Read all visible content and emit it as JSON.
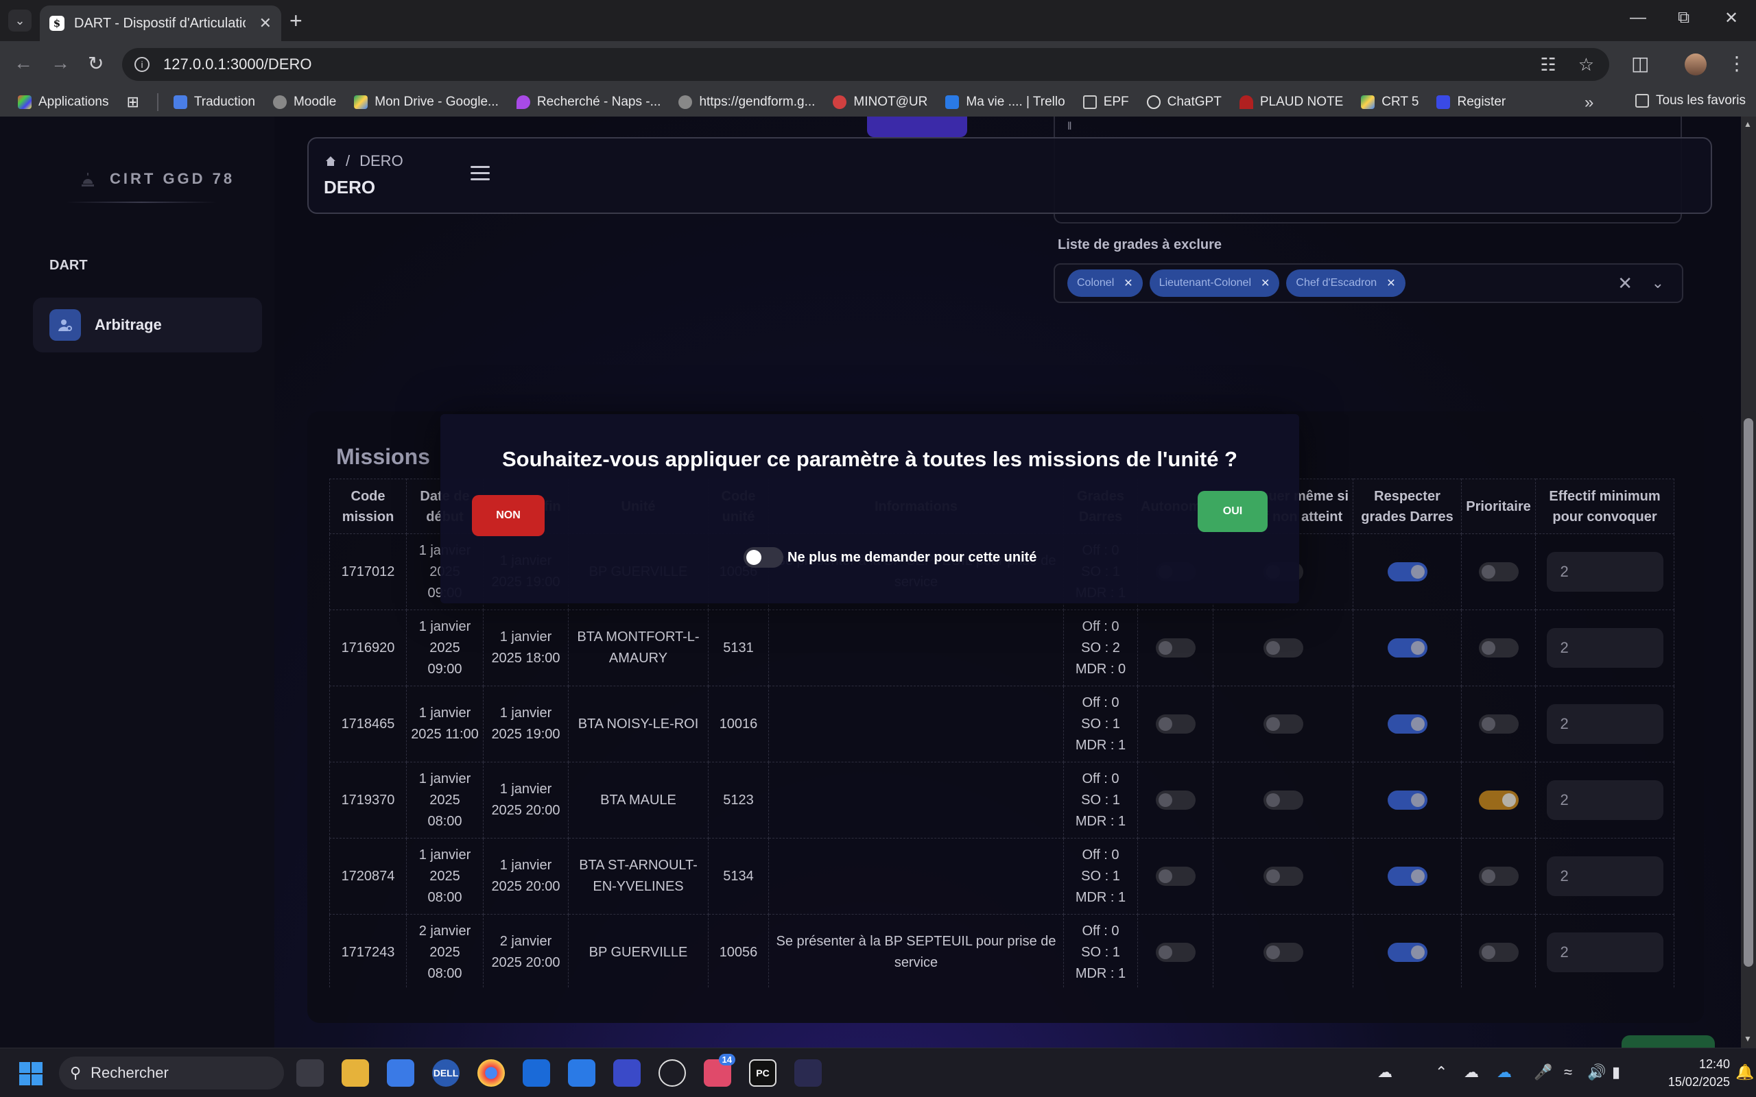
{
  "browser": {
    "tab_title": "DART - Dispostif d'Articulation d",
    "url": "127.0.0.1:3000/DERO",
    "bookmarks": [
      "Applications",
      "Traduction",
      "Moodle",
      "Mon Drive - Google...",
      "Recherché - Naps -...",
      "https://gendform.g...",
      "MINOT@UR",
      "Ma vie .... | Trello",
      "EPF",
      "ChatGPT",
      "PLAUD NOTE",
      "CRT 5",
      "Register"
    ],
    "all_bookmarks": "Tous les favoris"
  },
  "sidebar": {
    "brand": "CIRT GGD 78",
    "section": "DART",
    "item": "Arbitrage"
  },
  "header": {
    "crumb": "DERO",
    "title": "DERO"
  },
  "exclude": {
    "label": "Liste de grades à exclure",
    "chips": [
      "Colonel",
      "Lieutenant-Colonel",
      "Chef d'Escadron"
    ]
  },
  "missions": {
    "title": "Missions",
    "columns": [
      "Code mission",
      "Date de début",
      "Date de fin",
      "Unité",
      "Code unité",
      "Informations",
      "Grades Darres",
      "Autonomie",
      "Convoquer même si effectif non atteint",
      "Respecter grades Darres",
      "Prioritaire",
      "Effectif minimum pour convoquer"
    ],
    "rows": [
      {
        "code": "1717012",
        "start": "1 janvier 2025 09:00",
        "end": "1 janvier 2025 19:00",
        "unit": "BP GUERVILLE",
        "unit_code": "10056",
        "info": "Se présenter à la BP SEPTEUIL pour prise de service",
        "off": "Off : 0",
        "so": "SO : 1",
        "mdr": "MDR : 1",
        "autonomie": false,
        "convoquer": false,
        "respecter": true,
        "prioritaire": false,
        "effectif": "2"
      },
      {
        "code": "1716920",
        "start": "1 janvier 2025 09:00",
        "end": "1 janvier 2025 18:00",
        "unit": "BTA MONTFORT-L-AMAURY",
        "unit_code": "5131",
        "info": "",
        "off": "Off : 0",
        "so": "SO : 2",
        "mdr": "MDR : 0",
        "autonomie": false,
        "convoquer": false,
        "respecter": true,
        "prioritaire": false,
        "effectif": "2"
      },
      {
        "code": "1718465",
        "start": "1 janvier 2025 11:00",
        "end": "1 janvier 2025 19:00",
        "unit": "BTA NOISY-LE-ROI",
        "unit_code": "10016",
        "info": "",
        "off": "Off : 0",
        "so": "SO : 1",
        "mdr": "MDR : 1",
        "autonomie": false,
        "convoquer": false,
        "respecter": true,
        "prioritaire": false,
        "effectif": "2"
      },
      {
        "code": "1719370",
        "start": "1 janvier 2025 08:00",
        "end": "1 janvier 2025 20:00",
        "unit": "BTA MAULE",
        "unit_code": "5123",
        "info": "",
        "off": "Off : 0",
        "so": "SO : 1",
        "mdr": "MDR : 1",
        "autonomie": false,
        "convoquer": false,
        "respecter": true,
        "prioritaire": true,
        "effectif": "2"
      },
      {
        "code": "1720874",
        "start": "1 janvier 2025 08:00",
        "end": "1 janvier 2025 20:00",
        "unit": "BTA ST-ARNOULT-EN-YVELINES",
        "unit_code": "5134",
        "info": "",
        "off": "Off : 0",
        "so": "SO : 1",
        "mdr": "MDR : 1",
        "autonomie": false,
        "convoquer": false,
        "respecter": true,
        "prioritaire": false,
        "effectif": "2"
      },
      {
        "code": "1717243",
        "start": "2 janvier 2025 08:00",
        "end": "2 janvier 2025 20:00",
        "unit": "BP GUERVILLE",
        "unit_code": "10056",
        "info": "Se présenter à la BP SEPTEUIL pour prise de service",
        "off": "Off : 0",
        "so": "SO : 1",
        "mdr": "MDR : 1",
        "autonomie": false,
        "convoquer": false,
        "respecter": true,
        "prioritaire": false,
        "effectif": "2"
      }
    ]
  },
  "modal": {
    "title": "Souhaitez-vous appliquer ce paramètre à toutes les missions de l'unité ?",
    "no_label": "NON",
    "yes_label": "OUI",
    "toggle_label": "Ne plus me demander pour cette unité",
    "toggle_on": false
  },
  "taskbar": {
    "search_placeholder": "Rechercher",
    "mail_badge": "14",
    "time": "12:40",
    "date": "15/02/2025"
  },
  "colors": {
    "accent_blue": "#2f4fa8",
    "danger": "#c82322",
    "success": "#3da860",
    "warning": "#9a6a1a"
  }
}
